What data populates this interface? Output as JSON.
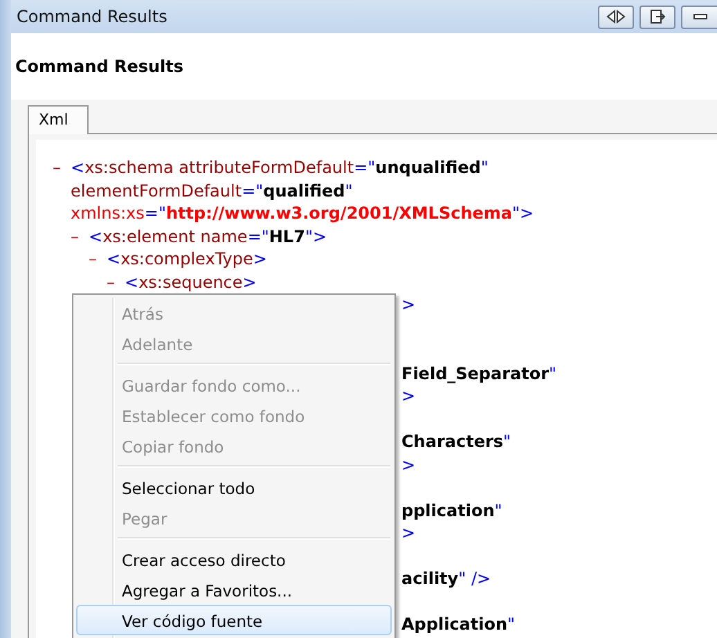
{
  "window": {
    "title": "Command Results"
  },
  "header": {
    "title": "Command Results"
  },
  "tabs": [
    {
      "label": "Xml",
      "selected": true
    }
  ],
  "xml_tree": [
    {
      "toggle": "–",
      "lines": [
        [
          {
            "kind": "punct",
            "text": "<"
          },
          {
            "kind": "name",
            "text": "xs:schema"
          },
          {
            "kind": "attr",
            "text": " attributeFormDefault"
          },
          {
            "kind": "punct",
            "text": "=\""
          },
          {
            "kind": "value",
            "text": "unqualified"
          },
          {
            "kind": "punct",
            "text": "\""
          }
        ],
        [
          {
            "kind": "attr",
            "text": "elementFormDefault"
          },
          {
            "kind": "punct",
            "text": "=\""
          },
          {
            "kind": "value",
            "text": "qualified"
          },
          {
            "kind": "punct",
            "text": "\""
          }
        ],
        [
          {
            "kind": "xmlns",
            "text": "xmlns:xs"
          },
          {
            "kind": "punct",
            "text": "=\""
          },
          {
            "kind": "url",
            "text": "http://www.w3.org/2001/XMLSchema"
          },
          {
            "kind": "punct",
            "text": "\">"
          }
        ]
      ],
      "children": [
        {
          "toggle": "–",
          "lines": [
            [
              {
                "kind": "punct",
                "text": "<"
              },
              {
                "kind": "name",
                "text": "xs:element"
              },
              {
                "kind": "attr",
                "text": " name"
              },
              {
                "kind": "punct",
                "text": "=\""
              },
              {
                "kind": "value",
                "text": "HL7"
              },
              {
                "kind": "punct",
                "text": "\">"
              }
            ]
          ],
          "children": [
            {
              "toggle": "–",
              "lines": [
                [
                  {
                    "kind": "punct",
                    "text": "<"
                  },
                  {
                    "kind": "name",
                    "text": "xs:complexType"
                  },
                  {
                    "kind": "punct",
                    "text": ">"
                  }
                ]
              ],
              "children": [
                {
                  "toggle": "–",
                  "lines": [
                    [
                      {
                        "kind": "punct",
                        "text": "<"
                      },
                      {
                        "kind": "name",
                        "text": "xs:sequence"
                      },
                      {
                        "kind": "punct",
                        "text": ">"
                      }
                    ]
                  ]
                }
              ]
            }
          ]
        }
      ]
    }
  ],
  "covered_lines": [
    {
      "kind": "fragment",
      "segments": [
        {
          "kind": "punct",
          "text": ">"
        }
      ]
    },
    {
      "kind": "hidden"
    },
    {
      "kind": "hidden"
    },
    {
      "kind": "fragment",
      "segments": [
        {
          "kind": "value",
          "text": "Field_Separator"
        },
        {
          "kind": "punct",
          "text": "\""
        }
      ]
    },
    {
      "kind": "fragment",
      "segments": [
        {
          "kind": "punct",
          "text": ">"
        }
      ]
    },
    {
      "kind": "hidden"
    },
    {
      "kind": "fragment",
      "segments": [
        {
          "kind": "value",
          "text": "Characters"
        },
        {
          "kind": "punct",
          "text": "\""
        }
      ]
    },
    {
      "kind": "fragment",
      "segments": [
        {
          "kind": "punct",
          "text": ">"
        }
      ]
    },
    {
      "kind": "hidden"
    },
    {
      "kind": "fragment",
      "segments": [
        {
          "kind": "value",
          "text": "pplication"
        },
        {
          "kind": "punct",
          "text": "\""
        }
      ]
    },
    {
      "kind": "fragment",
      "segments": [
        {
          "kind": "punct",
          "text": ">"
        }
      ]
    },
    {
      "kind": "hidden"
    },
    {
      "kind": "fragment",
      "segments": [
        {
          "kind": "value",
          "text": "acility"
        },
        {
          "kind": "punct",
          "text": "\" />"
        }
      ]
    },
    {
      "kind": "hidden"
    },
    {
      "kind": "fragment",
      "segments": [
        {
          "kind": "value",
          "text": "Application"
        },
        {
          "kind": "punct",
          "text": "\""
        }
      ]
    }
  ],
  "context_menu": [
    {
      "kind": "item",
      "label": "Atrás",
      "disabled": true,
      "selected": false
    },
    {
      "kind": "item",
      "label": "Adelante",
      "disabled": true,
      "selected": false
    },
    {
      "kind": "separator"
    },
    {
      "kind": "item",
      "label": "Guardar fondo como...",
      "disabled": true,
      "selected": false
    },
    {
      "kind": "item",
      "label": "Establecer como fondo",
      "disabled": true,
      "selected": false
    },
    {
      "kind": "item",
      "label": "Copiar fondo",
      "disabled": true,
      "selected": false
    },
    {
      "kind": "separator"
    },
    {
      "kind": "item",
      "label": "Seleccionar todo",
      "disabled": false,
      "selected": false
    },
    {
      "kind": "item",
      "label": "Pegar",
      "disabled": true,
      "selected": false
    },
    {
      "kind": "separator"
    },
    {
      "kind": "item",
      "label": "Crear acceso directo",
      "disabled": false,
      "selected": false
    },
    {
      "kind": "item",
      "label": "Agregar a Favoritos...",
      "disabled": false,
      "selected": false
    },
    {
      "kind": "item",
      "label": "Ver código fuente",
      "disabled": false,
      "selected": true
    }
  ]
}
